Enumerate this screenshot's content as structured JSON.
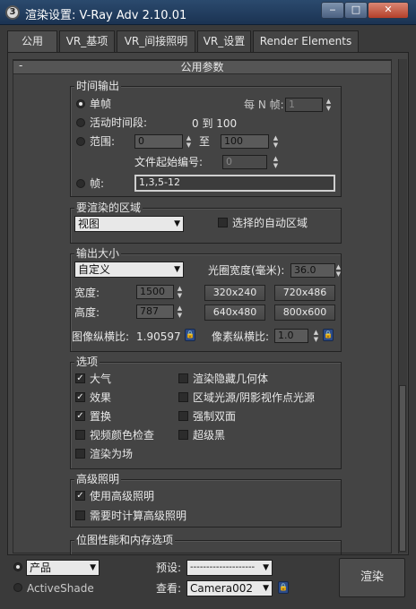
{
  "window": {
    "title": "渲染设置: V-Ray Adv 2.10.01",
    "app_icon": "3ds-max-icon",
    "min": "‒",
    "max": "□",
    "close": "✕"
  },
  "tabs": [
    {
      "label": "公用"
    },
    {
      "label": "VR_基项"
    },
    {
      "label": "VR_间接照明"
    },
    {
      "label": "VR_设置"
    },
    {
      "label": "Render Elements"
    }
  ],
  "rollout": {
    "title": "公用参数",
    "toggle": "-"
  },
  "time_output": {
    "title": "时间输出",
    "single": "单帧",
    "every_n_label": "每 N 帧:",
    "every_n_value": "1",
    "active_segment": "活动时间段:",
    "active_range": "0 到 100",
    "range": "范围:",
    "range_from": "0",
    "range_to_label": "至",
    "range_to": "100",
    "file_start_label": "文件起始编号:",
    "file_start_value": "0",
    "frames": "帧:",
    "frames_value": "1,3,5-12"
  },
  "render_area": {
    "title": "要渲染的区域",
    "mode": "视图",
    "auto_region": "选择的自动区域"
  },
  "output_size": {
    "title": "输出大小",
    "preset": "自定义",
    "aperture_label": "光圈宽度(毫米):",
    "aperture_value": "36.0",
    "width_label": "宽度:",
    "width_value": "1500",
    "height_label": "高度:",
    "height_value": "787",
    "presets": [
      "320x240",
      "720x486",
      "640x480",
      "800x600"
    ],
    "aspect_label": "图像纵横比:",
    "aspect_value": "1.90597",
    "pixel_aspect_label": "像素纵横比:",
    "pixel_aspect_value": "1.0"
  },
  "options": {
    "title": "选项",
    "left": [
      {
        "label": "大气",
        "checked": true
      },
      {
        "label": "效果",
        "checked": true
      },
      {
        "label": "置换",
        "checked": true
      },
      {
        "label": "视频颜色检查",
        "checked": false
      },
      {
        "label": "渲染为场",
        "checked": false
      }
    ],
    "right": [
      {
        "label": "渲染隐藏几何体",
        "checked": false
      },
      {
        "label": "区域光源/阴影视作点光源",
        "checked": false
      },
      {
        "label": "强制双面",
        "checked": false
      },
      {
        "label": "超级黑",
        "checked": false
      }
    ]
  },
  "advanced_lighting": {
    "title": "高级照明",
    "use": {
      "label": "使用高级照明",
      "checked": true
    },
    "compute": {
      "label": "需要时计算高级照明",
      "checked": false
    }
  },
  "bitmap": {
    "title": "位图性能和内存选项"
  },
  "bottom": {
    "product": "产品",
    "activeshade": "ActiveShade",
    "preset_label": "预设:",
    "preset_value": "--------------------",
    "view_label": "查看:",
    "view_value": "Camera002",
    "render": "渲染"
  },
  "colors": {
    "panel": "#444444",
    "titlebar": "#2b4a6e",
    "close": "#b5402a"
  }
}
